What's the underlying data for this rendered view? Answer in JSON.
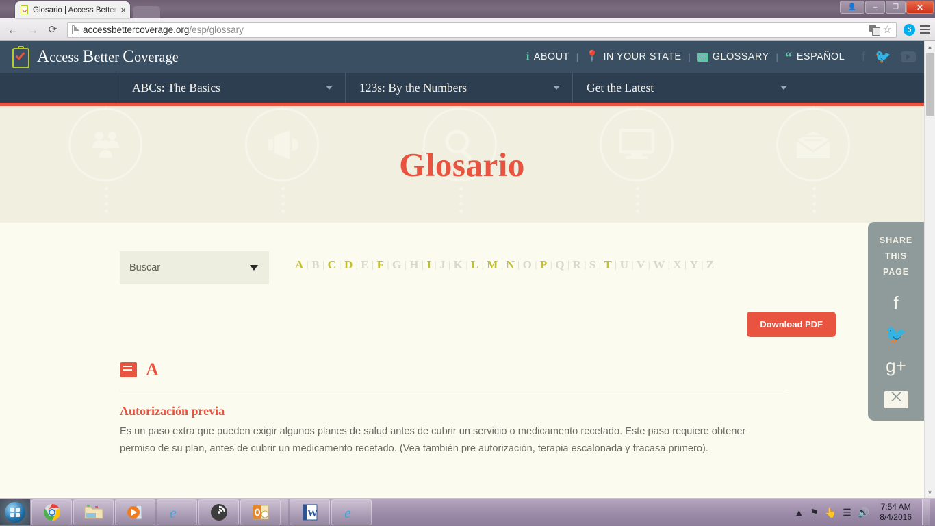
{
  "browser": {
    "tab_title": "Glosario | Access Better C",
    "tab_favicon": "clipboard-check-icon",
    "close_tab": "×",
    "back": "←",
    "forward": "→",
    "reload": "⟳",
    "url_main": "accessbettercoverage.org",
    "url_path": "/esp/glossary",
    "minimize": "–",
    "maximize": "❐",
    "close": "✕",
    "user": "●",
    "skype_label": "S"
  },
  "site": {
    "logo_a": "A",
    "logo_ccess": "ccess ",
    "logo_b": "B",
    "logo_etter": "etter ",
    "logo_c": "C",
    "logo_overage": "overage",
    "top_nav": [
      {
        "label": "ABOUT",
        "icon": "info-icon"
      },
      {
        "label": "IN YOUR STATE",
        "icon": "map-pin-icon"
      },
      {
        "label": "GLOSSARY",
        "icon": "book-icon"
      },
      {
        "label": "ESPAÑOL",
        "icon": "quote-icon"
      }
    ],
    "separator": "|",
    "social": [
      {
        "name": "facebook-icon",
        "glyph": "f"
      },
      {
        "name": "twitter-icon",
        "glyph": "🐦"
      },
      {
        "name": "youtube-icon",
        "glyph": ""
      }
    ],
    "main_nav": [
      {
        "label": "ABCs: The Basics"
      },
      {
        "label": "123s: By the Numbers"
      },
      {
        "label": "Get the Latest"
      }
    ],
    "accent_red": "#e8543f",
    "header_blue": "#3b4f63",
    "nav_blue": "#2d3e50"
  },
  "hero": {
    "title": "Glosario",
    "watermark_icons": [
      "people-group-icon",
      "megaphone-icon",
      "magnifier-icon",
      "monitor-icon",
      "envelope-icon"
    ],
    "background": "#f0efe0"
  },
  "main": {
    "search_placeholder": "Buscar",
    "alphabet": [
      {
        "letter": "A",
        "active": true
      },
      {
        "letter": "B",
        "active": false
      },
      {
        "letter": "C",
        "active": true
      },
      {
        "letter": "D",
        "active": true
      },
      {
        "letter": "E",
        "active": false
      },
      {
        "letter": "F",
        "active": true
      },
      {
        "letter": "G",
        "active": false
      },
      {
        "letter": "H",
        "active": false
      },
      {
        "letter": "I",
        "active": true
      },
      {
        "letter": "J",
        "active": false
      },
      {
        "letter": "K",
        "active": false
      },
      {
        "letter": "L",
        "active": true
      },
      {
        "letter": "M",
        "active": true
      },
      {
        "letter": "N",
        "active": true
      },
      {
        "letter": "O",
        "active": false
      },
      {
        "letter": "P",
        "active": true
      },
      {
        "letter": "Q",
        "active": false
      },
      {
        "letter": "R",
        "active": false
      },
      {
        "letter": "S",
        "active": false
      },
      {
        "letter": "T",
        "active": true
      },
      {
        "letter": "U",
        "active": false
      },
      {
        "letter": "V",
        "active": false
      },
      {
        "letter": "W",
        "active": false
      },
      {
        "letter": "X",
        "active": false
      },
      {
        "letter": "Y",
        "active": false
      },
      {
        "letter": "Z",
        "active": false
      }
    ],
    "download_pdf": "Download PDF",
    "section_letter": "A",
    "entries": [
      {
        "term": "Autorización previa",
        "definition": "Es un paso extra que pueden exigir algunos planes de salud antes de cubrir un servicio o medicamento recetado. Este paso requiere obtener permiso de su plan, antes de cubrir un medicamento recetado. (Vea también pre autorización, terapia escalonada y fracasa primero)."
      }
    ],
    "active_letter_color": "#c3c02c",
    "inactive_letter_color": "#d8d8cd"
  },
  "share": {
    "line1": "SHARE",
    "line2": "THIS",
    "line3": "PAGE",
    "icons": [
      {
        "name": "facebook-share-icon",
        "glyph": "f"
      },
      {
        "name": "twitter-share-icon",
        "glyph": "🐦"
      },
      {
        "name": "googleplus-share-icon",
        "glyph": "g+"
      },
      {
        "name": "email-share-icon",
        "glyph": ""
      }
    ],
    "background": "#8f9a9b"
  },
  "taskbar": {
    "start": "windows-start-orb",
    "apps": [
      "chrome-icon",
      "file-explorer-icon",
      "media-player-icon",
      "internet-explorer-icon",
      "circle-app-icon",
      "outlook-icon",
      "word-icon",
      "internet-explorer-icon-2"
    ],
    "tray": [
      "show-hidden-icons",
      "action-center-flag-icon",
      "network-icon",
      "signal-bars-icon",
      "volume-icon"
    ],
    "time": "7:54 AM",
    "date": "8/4/2016"
  }
}
